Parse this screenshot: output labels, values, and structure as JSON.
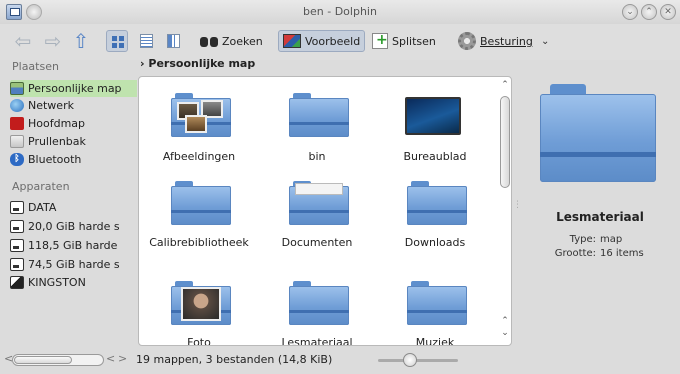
{
  "window": {
    "title": "ben - Dolphin"
  },
  "toolbar": {
    "search_label": "Zoeken",
    "preview_label": "Voorbeeld",
    "split_label": "Splitsen",
    "control_label": "Besturing"
  },
  "places": {
    "title": "Plaatsen",
    "items": [
      {
        "label": "Persoonlijke map",
        "icon": "home-folder-icon"
      },
      {
        "label": "Netwerk",
        "icon": "network-icon"
      },
      {
        "label": "Hoofdmap",
        "icon": "root-folder-icon"
      },
      {
        "label": "Prullenbak",
        "icon": "trash-icon"
      },
      {
        "label": "Bluetooth",
        "icon": "bluetooth-icon"
      }
    ],
    "devices_title": "Apparaten",
    "devices": [
      {
        "label": "DATA",
        "icon": "drive-icon"
      },
      {
        "label": "20,0 GiB harde s",
        "icon": "drive-icon"
      },
      {
        "label": "118,5 GiB harde",
        "icon": "drive-icon"
      },
      {
        "label": "74,5 GiB harde s",
        "icon": "drive-icon"
      },
      {
        "label": "KINGSTON",
        "icon": "usb-drive-icon"
      }
    ]
  },
  "breadcrumb": {
    "label": "Persoonlijke map"
  },
  "files": [
    {
      "label": "Afbeeldingen",
      "icon": "pictures-folder-icon"
    },
    {
      "label": "bin",
      "icon": "folder-icon"
    },
    {
      "label": "Bureaublad",
      "icon": "desktop-icon"
    },
    {
      "label": "Calibrebibliotheek",
      "icon": "folder-icon"
    },
    {
      "label": "Documenten",
      "icon": "documents-folder-icon"
    },
    {
      "label": "Downloads",
      "icon": "folder-icon"
    },
    {
      "label": "Foto",
      "icon": "photo-folder-icon"
    },
    {
      "label": "Lesmateriaal",
      "icon": "folder-icon"
    },
    {
      "label": "Muziek",
      "icon": "folder-icon"
    }
  ],
  "info": {
    "name": "Lesmateriaal",
    "type_key": "Type:",
    "type_value": "map",
    "size_key": "Grootte:",
    "size_value": "16 items"
  },
  "status": {
    "text": "19 mappen, 3 bestanden (14,8 KiB)"
  },
  "colors": {
    "accent": "#5e8fcd",
    "selection": "#bfe3ae"
  }
}
